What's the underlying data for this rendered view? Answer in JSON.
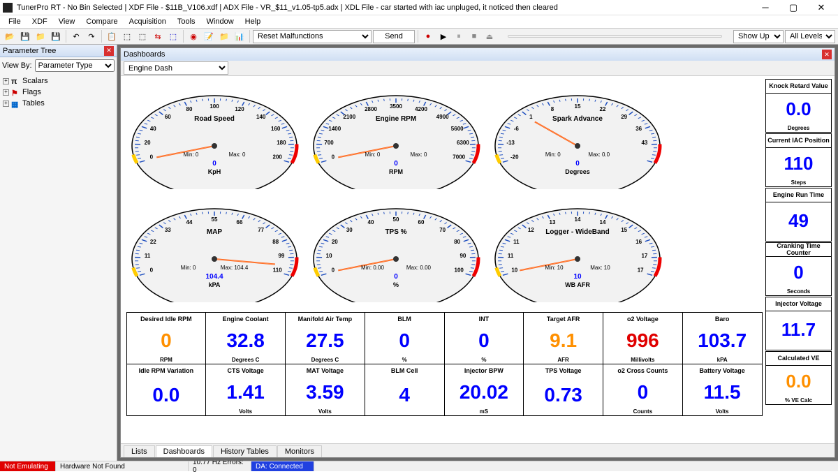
{
  "title": "TunerPro RT - No Bin Selected | XDF File - $11B_V106.xdf | ADX File - VR_$11_v1.05-tp5.adx | XDL File - car started with iac unpluged, it noticed then cleared",
  "menu": [
    "File",
    "XDF",
    "View",
    "Compare",
    "Acquisition",
    "Tools",
    "Window",
    "Help"
  ],
  "toolbar": {
    "combo1": "Reset Malfunctions",
    "send": "Send",
    "combo2": "Show Up To",
    "combo3": "All Levels"
  },
  "sidebar": {
    "title": "Parameter Tree",
    "viewby_label": "View By:",
    "viewby_value": "Parameter Type",
    "items": [
      {
        "icon": "π",
        "label": "Scalars"
      },
      {
        "icon": "⚑",
        "label": "Flags"
      },
      {
        "icon": "▦",
        "label": "Tables"
      }
    ]
  },
  "dash": {
    "title": "Dashboards",
    "selector": "Engine Dash",
    "gauges": [
      {
        "title": "Road Speed",
        "min": "Min: 0",
        "max": "Max: 0",
        "val": "0",
        "unit": "KpH",
        "ticks": [
          "0",
          "20",
          "40",
          "60",
          "80",
          "100",
          "120",
          "140",
          "160",
          "180",
          "200"
        ]
      },
      {
        "title": "Engine RPM",
        "min": "Min: 0",
        "max": "Max: 0",
        "val": "0",
        "unit": "RPM",
        "ticks": [
          "0",
          "700",
          "1400",
          "2100",
          "2800",
          "3500",
          "4200",
          "4900",
          "5600",
          "6300",
          "7000"
        ]
      },
      {
        "title": "Spark Advance",
        "min": "Min: 0",
        "max": "Max: 0.0",
        "val": "0",
        "unit": "Degrees",
        "ticks": [
          "-20",
          "-13",
          "-6",
          "1",
          "8",
          "15",
          "22",
          "29",
          "36",
          "43",
          ""
        ]
      },
      {
        "title": "MAP",
        "min": "Min: 0",
        "max": "Max: 104.4",
        "val": "104.4",
        "unit": "kPA",
        "ticks": [
          "0",
          "11",
          "22",
          "33",
          "44",
          "55",
          "66",
          "77",
          "88",
          "99",
          "110"
        ]
      },
      {
        "title": "TPS %",
        "min": "Min: 0.00",
        "max": "Max: 0.00",
        "val": "0",
        "unit": "%",
        "ticks": [
          "0",
          "10",
          "20",
          "30",
          "40",
          "50",
          "60",
          "70",
          "80",
          "90",
          "100"
        ]
      },
      {
        "title": "Logger - WideBand",
        "min": "Min: 10",
        "max": "Max: 10",
        "val": "10",
        "unit": "WB AFR",
        "ticks": [
          "10",
          "11",
          "11",
          "12",
          "13",
          "14",
          "14",
          "15",
          "16",
          "17",
          "17"
        ]
      }
    ],
    "side_tiles": [
      {
        "hdr": "Knock Retard Value",
        "val": "0.0",
        "unit": "Degrees",
        "cls": ""
      },
      {
        "hdr": "Current IAC Position",
        "val": "110",
        "unit": "Steps",
        "cls": ""
      },
      {
        "hdr": "Engine Run Time",
        "val": "49",
        "unit": "",
        "cls": ""
      },
      {
        "hdr": "Cranking Time Counter",
        "val": "0",
        "unit": "Seconds",
        "cls": ""
      },
      {
        "hdr": "Injector Voltage",
        "val": "11.7",
        "unit": "",
        "cls": ""
      },
      {
        "hdr": "Calculated VE",
        "val": "0.0",
        "unit": "% VE Calc",
        "cls": "orange"
      }
    ],
    "grid_tiles": [
      {
        "hdr": "Desired Idle RPM",
        "val": "0",
        "unit": "RPM",
        "cls": "orange"
      },
      {
        "hdr": "Engine Coolant",
        "val": "32.8",
        "unit": "Degrees C",
        "cls": ""
      },
      {
        "hdr": "Manifold Air Temp",
        "val": "27.5",
        "unit": "Degrees C",
        "cls": ""
      },
      {
        "hdr": "BLM",
        "val": "0",
        "unit": "%",
        "cls": ""
      },
      {
        "hdr": "INT",
        "val": "0",
        "unit": "%",
        "cls": ""
      },
      {
        "hdr": "Target AFR",
        "val": "9.1",
        "unit": "AFR",
        "cls": "orange"
      },
      {
        "hdr": "o2 Voltage",
        "val": "996",
        "unit": "Millivolts",
        "cls": "red"
      },
      {
        "hdr": "Baro",
        "val": "103.7",
        "unit": "kPA",
        "cls": ""
      },
      {
        "hdr": "Idle RPM Variation",
        "val": "0.0",
        "unit": "",
        "cls": ""
      },
      {
        "hdr": "CTS Voltage",
        "val": "1.41",
        "unit": "Volts",
        "cls": ""
      },
      {
        "hdr": "MAT Voltage",
        "val": "3.59",
        "unit": "Volts",
        "cls": ""
      },
      {
        "hdr": "BLM Cell",
        "val": "4",
        "unit": "",
        "cls": ""
      },
      {
        "hdr": "Injector BPW",
        "val": "20.02",
        "unit": "mS",
        "cls": ""
      },
      {
        "hdr": "TPS Voltage",
        "val": "0.73",
        "unit": "",
        "cls": ""
      },
      {
        "hdr": "o2 Cross Counts",
        "val": "0",
        "unit": "Counts",
        "cls": ""
      },
      {
        "hdr": "Battery Voltage",
        "val": "11.5",
        "unit": "Volts",
        "cls": ""
      }
    ],
    "tabs": [
      "Lists",
      "Dashboards",
      "History Tables",
      "Monitors"
    ],
    "active_tab": 1
  },
  "status": {
    "emulating": "Not Emulating",
    "hardware": "Hardware Not Found",
    "rate": "10.77 Hz   Errors: 0",
    "da": "DA: Connected"
  }
}
